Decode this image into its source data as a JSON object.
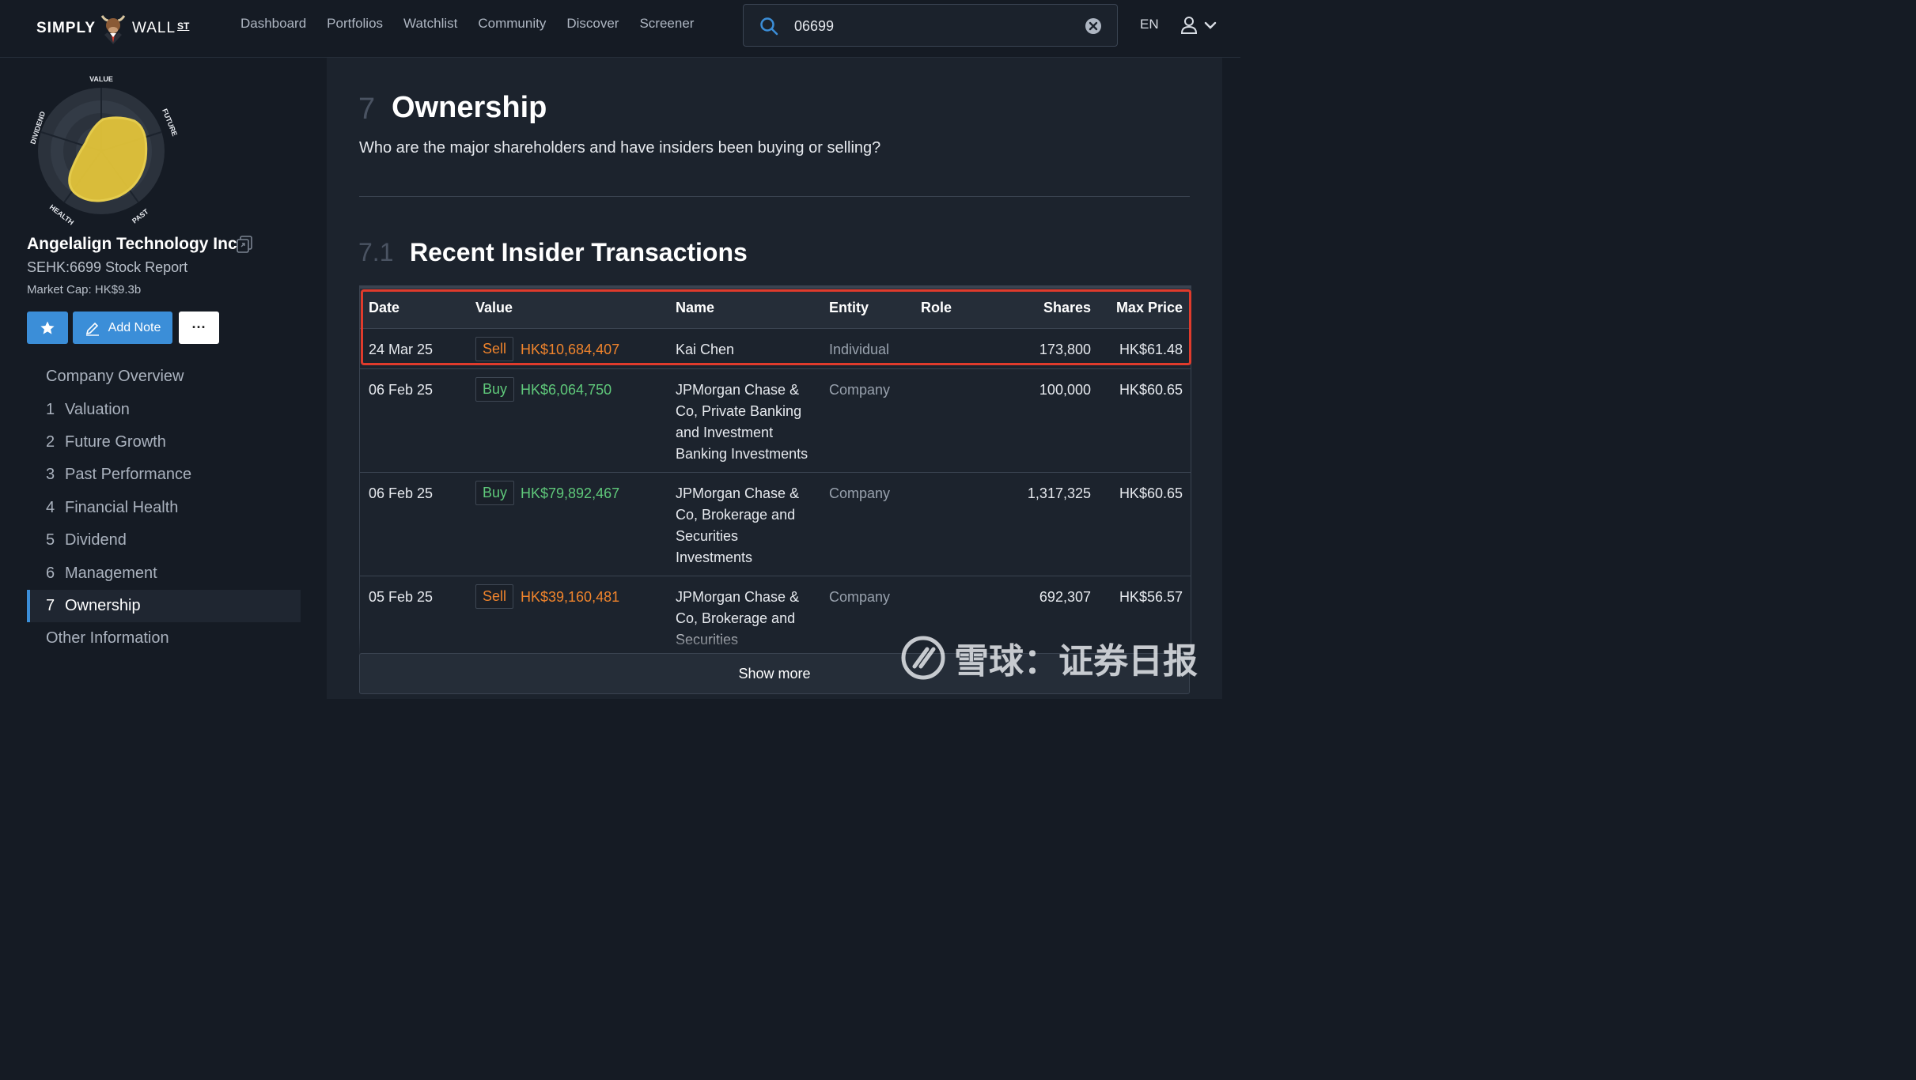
{
  "topnav": {
    "logo": {
      "simply": "SIMPLY",
      "wall": "WALL",
      "st": "ST"
    },
    "links": [
      "Dashboard",
      "Portfolios",
      "Watchlist",
      "Community",
      "Discover",
      "Screener"
    ],
    "search_value": "06699",
    "language": "EN"
  },
  "sidebar": {
    "snowflake_axes": {
      "value": "VALUE",
      "future": "FUTURE",
      "past": "PAST",
      "health": "HEALTH",
      "dividend": "DIVIDEND"
    },
    "company_name": "Angelalign Technology Inc.",
    "ticker": "SEHK:6699 Stock Report",
    "market_cap": "Market Cap: HK$9.3b",
    "add_note_label": "Add Note",
    "more_label": "···",
    "toc": [
      {
        "num": "",
        "label": "Company Overview"
      },
      {
        "num": "1",
        "label": "Valuation"
      },
      {
        "num": "2",
        "label": "Future Growth"
      },
      {
        "num": "3",
        "label": "Past Performance"
      },
      {
        "num": "4",
        "label": "Financial Health"
      },
      {
        "num": "5",
        "label": "Dividend"
      },
      {
        "num": "6",
        "label": "Management"
      },
      {
        "num": "7",
        "label": "Ownership"
      },
      {
        "num": "",
        "label": "Other Information"
      }
    ],
    "active_index": 7
  },
  "main": {
    "section_num": "7",
    "section_title": "Ownership",
    "section_subtitle": "Who are the major shareholders and have insiders been buying or selling?",
    "subsection_num": "7.1",
    "subsection_title": "Recent Insider Transactions",
    "table": {
      "headers": {
        "date": "Date",
        "value": "Value",
        "name": "Name",
        "entity": "Entity",
        "role": "Role",
        "shares": "Shares",
        "max_price": "Max Price"
      },
      "rows": [
        {
          "date": "24 Mar 25",
          "type": "Sell",
          "value": "HK$10,684,407",
          "name": "Kai Chen",
          "entity": "Individual",
          "role": "",
          "shares": "173,800",
          "max_price": "HK$61.48"
        },
        {
          "date": "06 Feb 25",
          "type": "Buy",
          "value": "HK$6,064,750",
          "name": "JPMorgan Chase & Co, Private Banking and Investment Banking Investments",
          "entity": "Company",
          "role": "",
          "shares": "100,000",
          "max_price": "HK$60.65"
        },
        {
          "date": "06 Feb 25",
          "type": "Buy",
          "value": "HK$79,892,467",
          "name": "JPMorgan Chase & Co, Brokerage and Securities Investments",
          "entity": "Company",
          "role": "",
          "shares": "1,317,325",
          "max_price": "HK$60.65"
        },
        {
          "date": "05 Feb 25",
          "type": "Sell",
          "value": "HK$39,160,481",
          "name": "JPMorgan Chase & Co, Brokerage and Securities",
          "entity": "Company",
          "role": "",
          "shares": "692,307",
          "max_price": "HK$56.57"
        }
      ]
    },
    "show_more_label": "Show more"
  },
  "watermark": {
    "text": "雪球：证券日报"
  },
  "colors": {
    "accent": "#3b8ed8",
    "sell": "#f0842c",
    "buy": "#5fc87a",
    "highlight": "#e03b2c",
    "snowflake": "#e8c83a"
  }
}
